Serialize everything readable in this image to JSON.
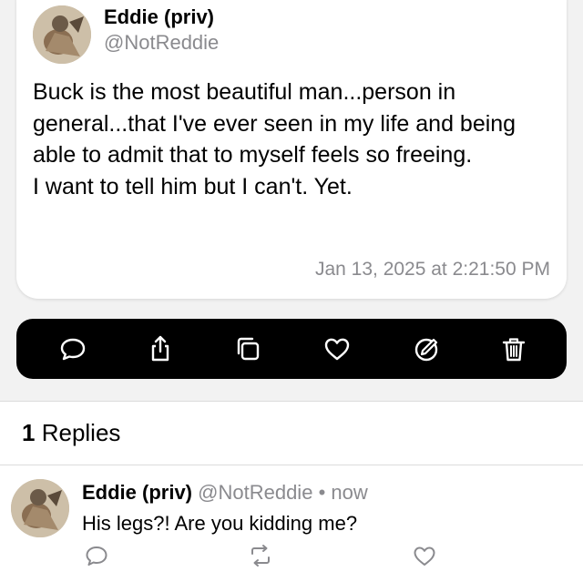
{
  "post": {
    "author_name": "Eddie (priv)",
    "author_handle": "@NotReddie",
    "body": "Buck is the most beautiful man...person in general...that I've ever seen in my life and being able to admit that to myself feels so freeing.\nI want to tell him but I can't. Yet.",
    "timestamp": "Jan 13, 2025 at 2:21:50 PM"
  },
  "action_bar": {
    "icons": [
      "reply-icon",
      "share-icon",
      "copy-icon",
      "like-icon",
      "edit-icon",
      "delete-icon"
    ],
    "background": "#000000",
    "icon_color": "#ffffff"
  },
  "replies": {
    "count": "1",
    "label": "Replies",
    "items": [
      {
        "author_name": "Eddie (priv)",
        "author_handle": "@NotReddie",
        "separator": "•",
        "time": "now",
        "text": "His legs?! Are you kidding me?"
      }
    ]
  },
  "colors": {
    "secondary_text": "#8a8a8e",
    "page_background": "#f2f2f2"
  }
}
